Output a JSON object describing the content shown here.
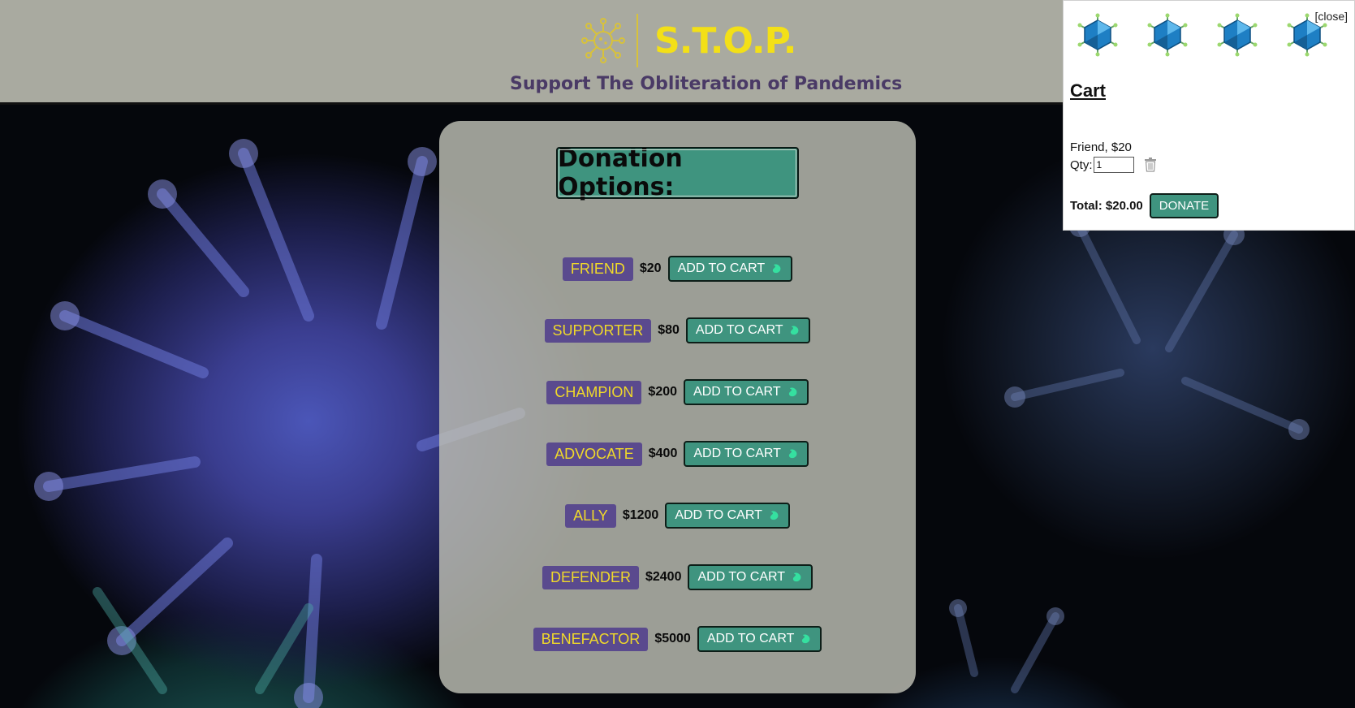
{
  "header": {
    "logo_text": "S.T.O.P.",
    "tagline": "Support The Obliteration of Pandemics"
  },
  "donations": {
    "title": "Donation Options:",
    "add_to_cart_label": "ADD TO CART",
    "tiers": [
      {
        "name": "FRIEND",
        "price": "$20"
      },
      {
        "name": "SUPPORTER",
        "price": "$80"
      },
      {
        "name": "CHAMPION",
        "price": "$200"
      },
      {
        "name": "ADVOCATE",
        "price": "$400"
      },
      {
        "name": "ALLY",
        "price": "$1200"
      },
      {
        "name": "DEFENDER",
        "price": "$2400"
      },
      {
        "name": "BENEFACTOR",
        "price": "$5000"
      }
    ]
  },
  "cart": {
    "close_label": "[close]",
    "title": "Cart",
    "item_text": "Friend, $20",
    "qty_label": "Qty:",
    "qty_value": "1",
    "total_text": "Total: $20.00",
    "donate_label": "DONATE"
  },
  "colors": {
    "accent_teal": "#3f947f",
    "tier_purple": "#5a4a8e",
    "title_yellow": "#f3e017",
    "header_gray": "#a9aaa0"
  },
  "icons": {
    "logo": "virus-logo-icon",
    "cart_decor": "virus-icon",
    "add_button": "bean-icon",
    "remove_item": "trash-icon"
  }
}
